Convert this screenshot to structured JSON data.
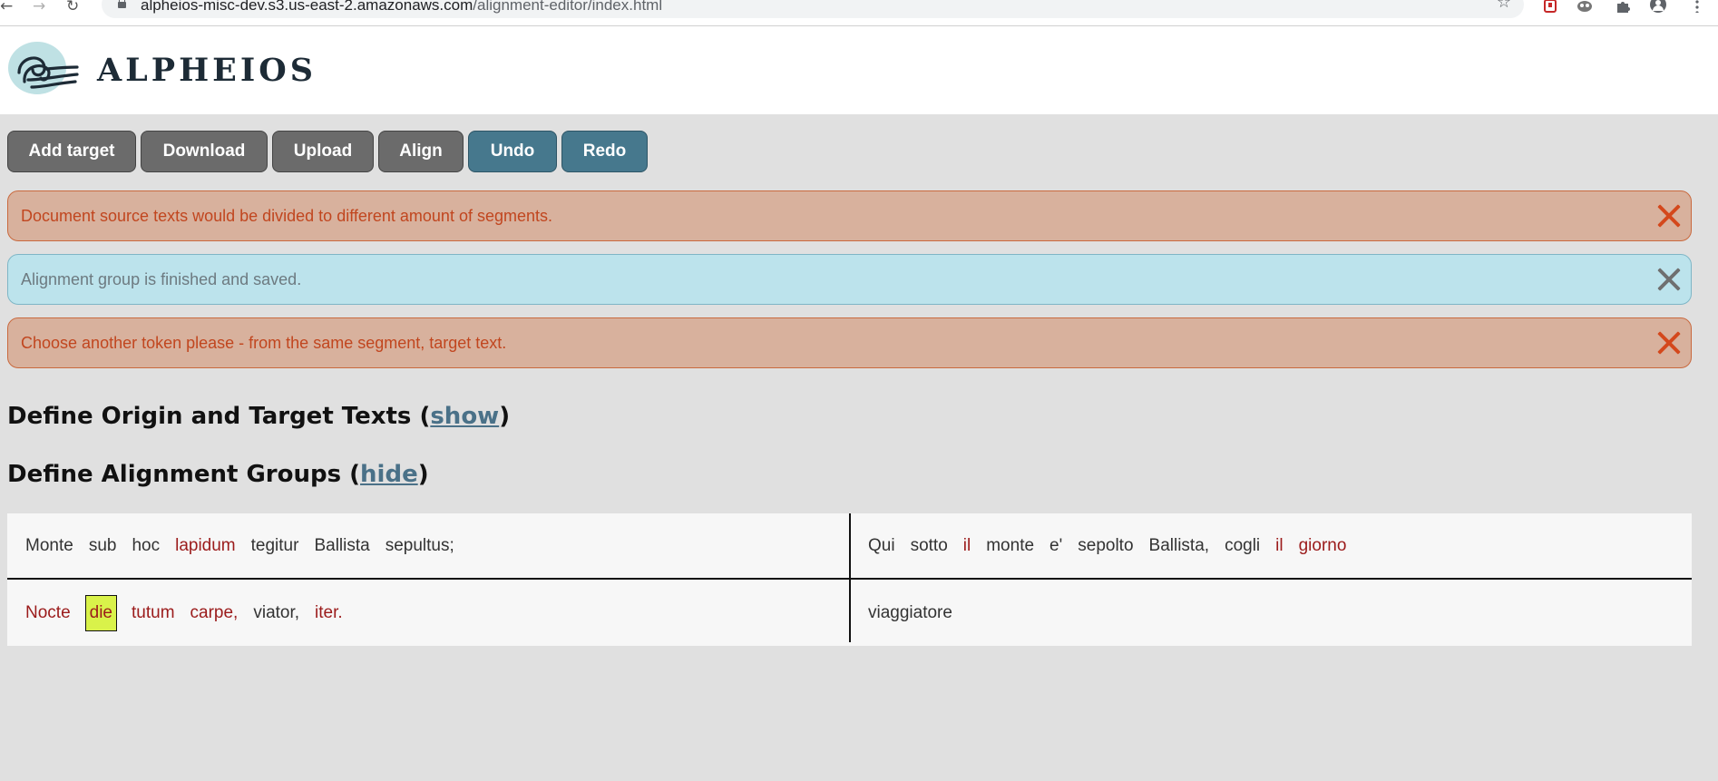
{
  "browser": {
    "url_host": "alpheios-misc-dev.s3.us-east-2.amazonaws.com",
    "url_path": "/alignment-editor/index.html",
    "nav": [
      "back-icon",
      "forward-icon",
      "reload-icon"
    ],
    "extensions": [
      "bookmark-star-icon",
      "extension-red-icon",
      "extension-owl-icon",
      "puzzle-icon",
      "profile-icon",
      "menu-dots-icon"
    ]
  },
  "header": {
    "logo_text": "ALPHEIOS"
  },
  "toolbar": {
    "buttons": [
      {
        "label": "Add target",
        "style": "gray"
      },
      {
        "label": "Download",
        "style": "gray"
      },
      {
        "label": "Upload",
        "style": "gray"
      },
      {
        "label": "Align",
        "style": "gray"
      },
      {
        "label": "Undo",
        "style": "blue"
      },
      {
        "label": "Redo",
        "style": "blue"
      }
    ]
  },
  "alerts": [
    {
      "type": "error",
      "message": "Document source texts would be divided to different amount of segments."
    },
    {
      "type": "info",
      "message": "Alignment group is finished and saved."
    },
    {
      "type": "error",
      "message": "Choose another token please - from the same segment, target text."
    }
  ],
  "sections": {
    "texts": {
      "title": "Define Origin and Target Texts",
      "toggle": "show"
    },
    "groups": {
      "title": "Define Alignment Groups",
      "toggle": "hide"
    }
  },
  "segments": [
    {
      "origin": [
        {
          "text": "Monte",
          "grouped": false
        },
        {
          "text": "sub",
          "grouped": false
        },
        {
          "text": "hoc",
          "grouped": false
        },
        {
          "text": "lapidum",
          "grouped": true
        },
        {
          "text": "tegitur",
          "grouped": false
        },
        {
          "text": "Ballista",
          "grouped": false
        },
        {
          "text": "sepultus;",
          "grouped": false
        }
      ],
      "target": [
        {
          "text": "Qui",
          "grouped": false
        },
        {
          "text": "sotto",
          "grouped": false
        },
        {
          "text": "il",
          "grouped": true
        },
        {
          "text": "monte",
          "grouped": false
        },
        {
          "text": "e'",
          "grouped": false
        },
        {
          "text": "sepolto",
          "grouped": false
        },
        {
          "text": "Ballista,",
          "grouped": false
        },
        {
          "text": "cogli",
          "grouped": false
        },
        {
          "text": "il",
          "grouped": true
        },
        {
          "text": "giorno",
          "grouped": true
        }
      ]
    },
    {
      "origin": [
        {
          "text": "Nocte",
          "grouped": true
        },
        {
          "text": "die",
          "grouped": true,
          "selected": true
        },
        {
          "text": "tutum",
          "grouped": true
        },
        {
          "text": "carpe,",
          "grouped": true
        },
        {
          "text": "viator,",
          "grouped": false
        },
        {
          "text": "iter.",
          "grouped": true
        }
      ],
      "target": [
        {
          "text": "viaggiatore",
          "grouped": false
        }
      ]
    }
  ],
  "colors": {
    "page_bg": "#e0e0e0",
    "button_gray": "#6b6b6b",
    "button_blue": "#46788d",
    "error_bg": "#d8b19d",
    "error_text": "#c1461f",
    "info_bg": "#bce3ec",
    "grouped_token": "#9b1b1b",
    "selected_token_bg": "#d9f24a"
  }
}
